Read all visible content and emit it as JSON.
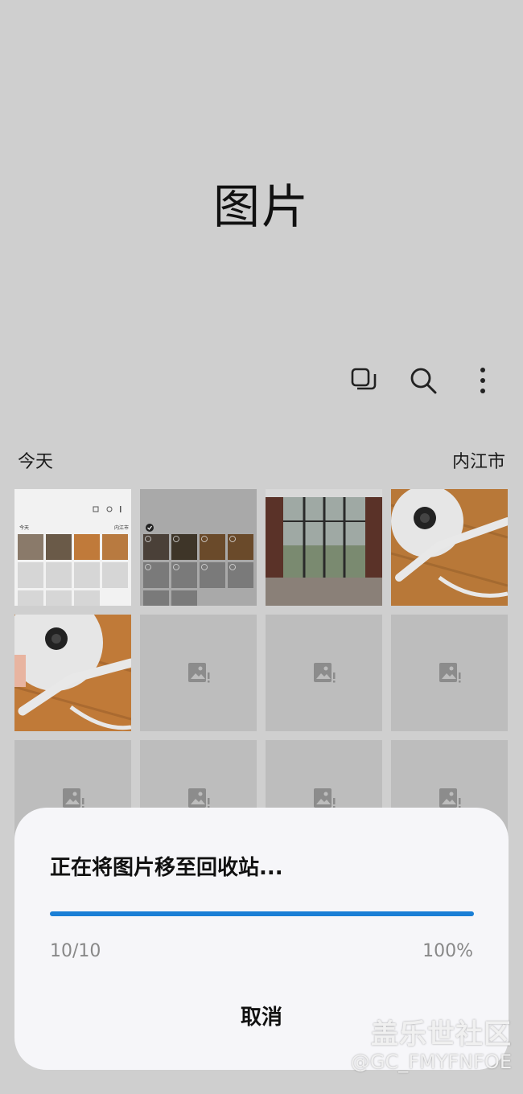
{
  "app": {
    "title": "图片"
  },
  "toolbar": {
    "icons": [
      "select-icon",
      "search-icon",
      "more-vertical-icon"
    ]
  },
  "section": {
    "date_label": "今天",
    "location_label": "内江市"
  },
  "thumbnails": [
    {
      "kind": "screenshot"
    },
    {
      "kind": "screenshot-selected"
    },
    {
      "kind": "room-photo"
    },
    {
      "kind": "camera-photo"
    },
    {
      "kind": "camera-photo"
    },
    {
      "kind": "placeholder"
    },
    {
      "kind": "placeholder"
    },
    {
      "kind": "placeholder"
    },
    {
      "kind": "placeholder"
    },
    {
      "kind": "placeholder"
    },
    {
      "kind": "placeholder"
    },
    {
      "kind": "placeholder"
    }
  ],
  "mini_preview": {
    "date_label": "今天",
    "location_label": "内江市"
  },
  "dialog": {
    "message": "正在将图片移至回收站...",
    "progress_fraction": 1.0,
    "count": "10/10",
    "percent": "100%",
    "cancel_label": "取消"
  },
  "watermark": {
    "site": "盖乐世社区",
    "user": "@GC_FMYFNFOE"
  },
  "colors": {
    "background": "#cfcfcf",
    "accent": "#1a7fd6",
    "dialog_bg": "#f6f6f9"
  }
}
